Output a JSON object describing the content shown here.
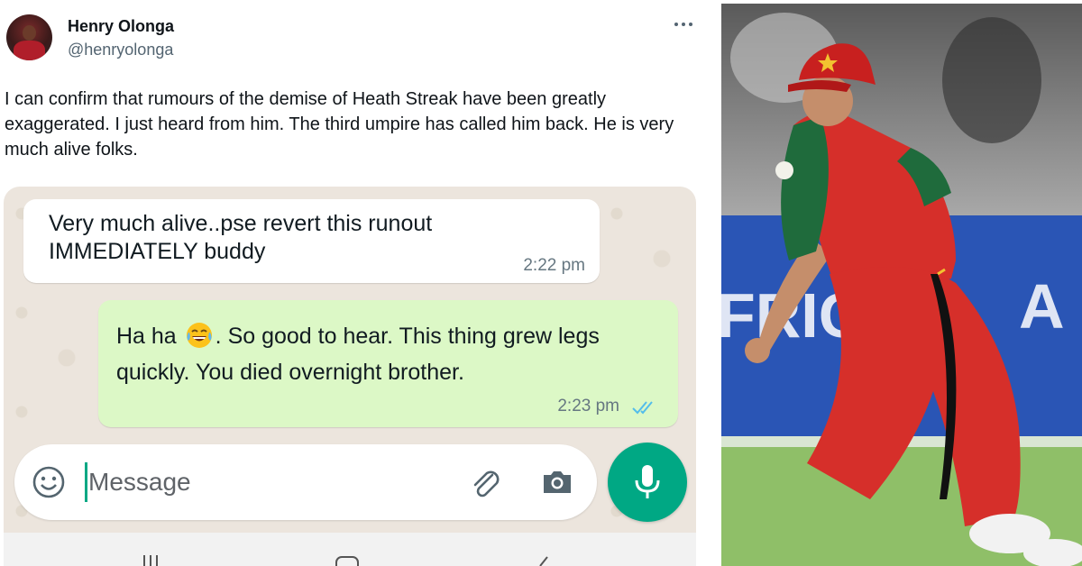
{
  "tweet": {
    "author_name": "Henry Olonga",
    "author_handle": "@henryolonga",
    "more_icon": "more-horizontal-icon",
    "text": "I can confirm that rumours of the demise of Heath Streak have been greatly exaggerated.  I just heard from him. The third umpire has called him back. He is very much alive folks."
  },
  "chat": {
    "messages": [
      {
        "direction": "incoming",
        "text": "Very much alive..pse revert this runout IMMEDIATELY buddy",
        "time": "2:22 pm"
      },
      {
        "direction": "outgoing",
        "text_before": "Ha ha",
        "emoji": "face-with-tears-of-joy",
        "text_after": ".  So good to hear. This thing grew legs quickly. You died overnight brother.",
        "time": "2:23 pm",
        "status": "read"
      }
    ],
    "composer": {
      "placeholder": "Message",
      "icons": [
        "smiley-icon",
        "paperclip-icon",
        "camera-icon",
        "microphone-icon"
      ]
    },
    "colors": {
      "incoming_bubble": "#ffffff",
      "outgoing_bubble": "#dcf8c6",
      "accent": "#00a884",
      "read_ticks": "#53bdeb",
      "wallpaper": "#ece5dd"
    }
  },
  "photo": {
    "subject": "cricketer-fielding",
    "colors": {
      "shirt": "#d62f2a",
      "shirt_panel": "#1f6b3c",
      "cap": "#c8201f",
      "pitch": "#8fbf68",
      "hoarding": "#2a55b5"
    }
  }
}
